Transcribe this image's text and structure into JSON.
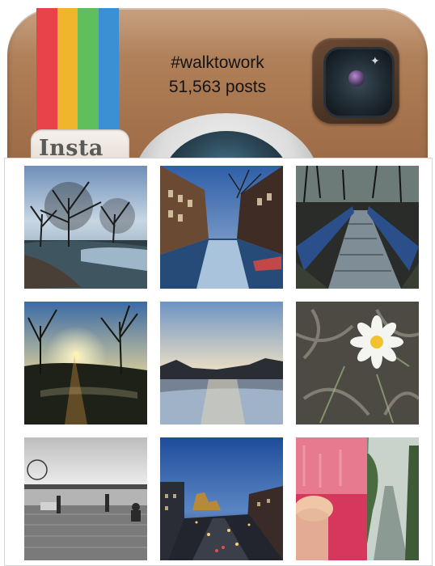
{
  "hashtag": "#walktowork",
  "posts_count": "51,563 posts",
  "logo_text": "Insta",
  "stripe_colors": [
    "#e8434b",
    "#f1b52d",
    "#5fbf5d",
    "#3b8fd4"
  ],
  "photos": [
    {
      "name": "photo-river-trees-sunrise"
    },
    {
      "name": "photo-canal-houses"
    },
    {
      "name": "photo-wooden-footbridge"
    },
    {
      "name": "photo-sunset-behind-trees"
    },
    {
      "name": "photo-calm-river-dusk"
    },
    {
      "name": "photo-frosted-daisy"
    },
    {
      "name": "photo-waterfront-black-white"
    },
    {
      "name": "photo-city-street-night"
    },
    {
      "name": "photo-smoothie-path"
    }
  ]
}
